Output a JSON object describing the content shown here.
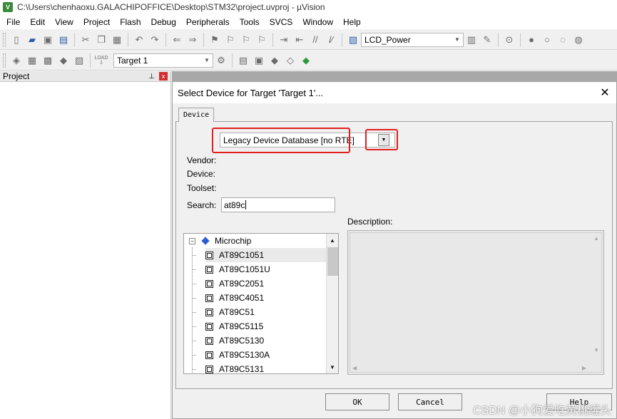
{
  "window": {
    "title": "C:\\Users\\chenhaoxu.GALACHIPOFFICE\\Desktop\\STM32\\project.uvproj - µVision",
    "app_icon": "V"
  },
  "menu": [
    "File",
    "Edit",
    "View",
    "Project",
    "Flash",
    "Debug",
    "Peripherals",
    "Tools",
    "SVCS",
    "Window",
    "Help"
  ],
  "toolbar": {
    "function_combo": "LCD_Power",
    "target_combo": "Target 1",
    "load_label": "LOAD"
  },
  "project_panel": {
    "title": "Project",
    "pin": "p",
    "close": "x"
  },
  "dialog": {
    "title": "Select Device for Target 'Target 1'...",
    "tab": "Device",
    "database": "Legacy Device Database [no RTE]",
    "vendor_label": "Vendor:",
    "device_label": "Device:",
    "toolset_label": "Toolset:",
    "search_label": "Search:",
    "search_value": "at89c",
    "description_label": "Description:",
    "tree": {
      "vendor": "Microchip",
      "devices": [
        "AT89C1051",
        "AT89C1051U",
        "AT89C2051",
        "AT89C4051",
        "AT89C51",
        "AT89C5115",
        "AT89C5130",
        "AT89C5130A",
        "AT89C5131"
      ],
      "selected_index": 0
    },
    "buttons": {
      "ok": "OK",
      "cancel": "Cancel",
      "help": "Help"
    }
  },
  "watermark": "CSDN @小狗爱吃黄桃罐头",
  "colors": {
    "highlight": "#e02020",
    "accent": "#2a5fa8"
  }
}
